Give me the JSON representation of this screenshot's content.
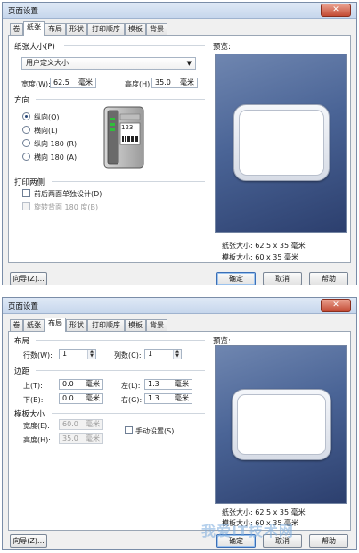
{
  "dialog1": {
    "title": "页面设置",
    "close_glyph": "✕",
    "tabs": [
      "卷",
      "纸张",
      "布局",
      "形状",
      "打印顺序",
      "模板",
      "背景"
    ],
    "paper_size_group": "纸张大小(P)",
    "paper_size_value": "用户定义大小",
    "width_label": "宽度(W):",
    "width_value": "62.5",
    "width_unit": "毫米",
    "height_label": "高度(H):",
    "height_value": "35.0",
    "height_unit": "毫米",
    "orientation_group": "方向",
    "orientations": [
      "纵向(O)",
      "横向(L)",
      "纵向 180 (R)",
      "横向 180 (A)"
    ],
    "printer_display": "123",
    "duplex_group": "打印两侧",
    "duplex_option1": "前后两面单独设计(D)",
    "duplex_option2": "旋转背面 180 度(B)",
    "preview_label": "预览:",
    "preview_paper": "纸张大小: 62.5 x 35 毫米",
    "preview_template": "模板大小: 60 x 35 毫米",
    "wizard_button": "向导(Z)...",
    "ok_button": "确定",
    "cancel_button": "取消",
    "help_button": "帮助"
  },
  "dialog2": {
    "title": "页面设置",
    "close_glyph": "✕",
    "tabs": [
      "卷",
      "纸张",
      "布局",
      "形状",
      "打印顺序",
      "模板",
      "背景"
    ],
    "layout_group": "布局",
    "rows_label": "行数(W):",
    "rows_value": "1",
    "cols_label": "列数(C):",
    "cols_value": "1",
    "margins_group": "边距",
    "top_label": "上(T):",
    "top_value": "0.0",
    "left_label": "左(L):",
    "left_value": "1.3",
    "bottom_label": "下(B):",
    "bottom_value": "0.0",
    "right_label": "右(G):",
    "right_value": "1.3",
    "unit": "毫米",
    "template_group": "模板大小",
    "tpl_width_label": "宽度(E):",
    "tpl_width_value": "60.0",
    "tpl_height_label": "高度(H):",
    "tpl_height_value": "35.0",
    "manual_label": "手动设置(S)",
    "preview_label": "预览:",
    "preview_paper": "纸张大小: 62.5 x 35 毫米",
    "preview_template": "模板大小: 60 x 35 毫米",
    "wizard_button": "向导(Z)...",
    "ok_button": "确定",
    "cancel_button": "取消",
    "help_button": "帮助"
  },
  "watermark": "我爱IT技术网"
}
